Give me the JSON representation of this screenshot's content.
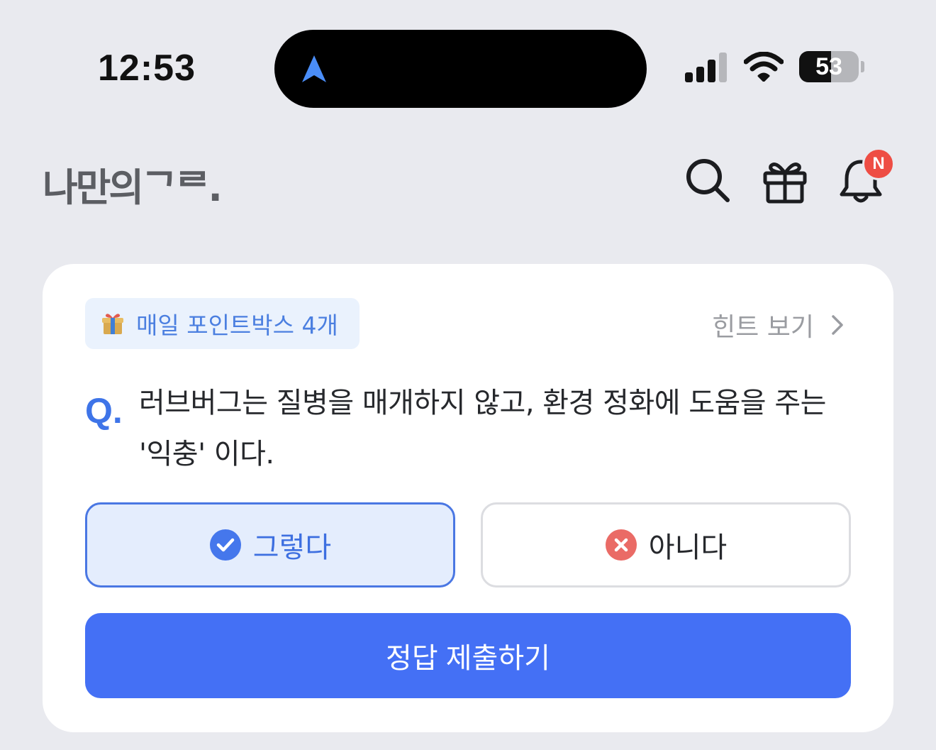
{
  "status_bar": {
    "time": "12:53",
    "battery": "53",
    "battery_level": 0.53,
    "signal_bars": 3,
    "icons": [
      "navigation-arrow-icon",
      "cellular-signal-icon",
      "wifi-icon",
      "battery-icon"
    ]
  },
  "header": {
    "logo": "나만의ᄀᄅ.",
    "icons": [
      "search-icon",
      "gift-icon",
      "bell-icon"
    ],
    "notification_badge": "N"
  },
  "quiz": {
    "pointbox_label": "매일 포인트박스 4개",
    "hint_label": "힌트 보기",
    "q_mark": "Q.",
    "question": "러브버그는 질병을 매개하지 않고, 환경 정화에 도움을 주는 '익충' 이다.",
    "options": [
      {
        "label": "그렇다",
        "selected": true,
        "icon": "check-circle-icon"
      },
      {
        "label": "아니다",
        "selected": false,
        "icon": "x-circle-icon"
      }
    ],
    "submit_label": "정답 제출하기"
  },
  "colors": {
    "background": "#e9eaef",
    "accent": "#4470f5",
    "selected_bg": "#e4edfd",
    "badge": "#ee4d44",
    "no_icon": "#ea6b66"
  }
}
